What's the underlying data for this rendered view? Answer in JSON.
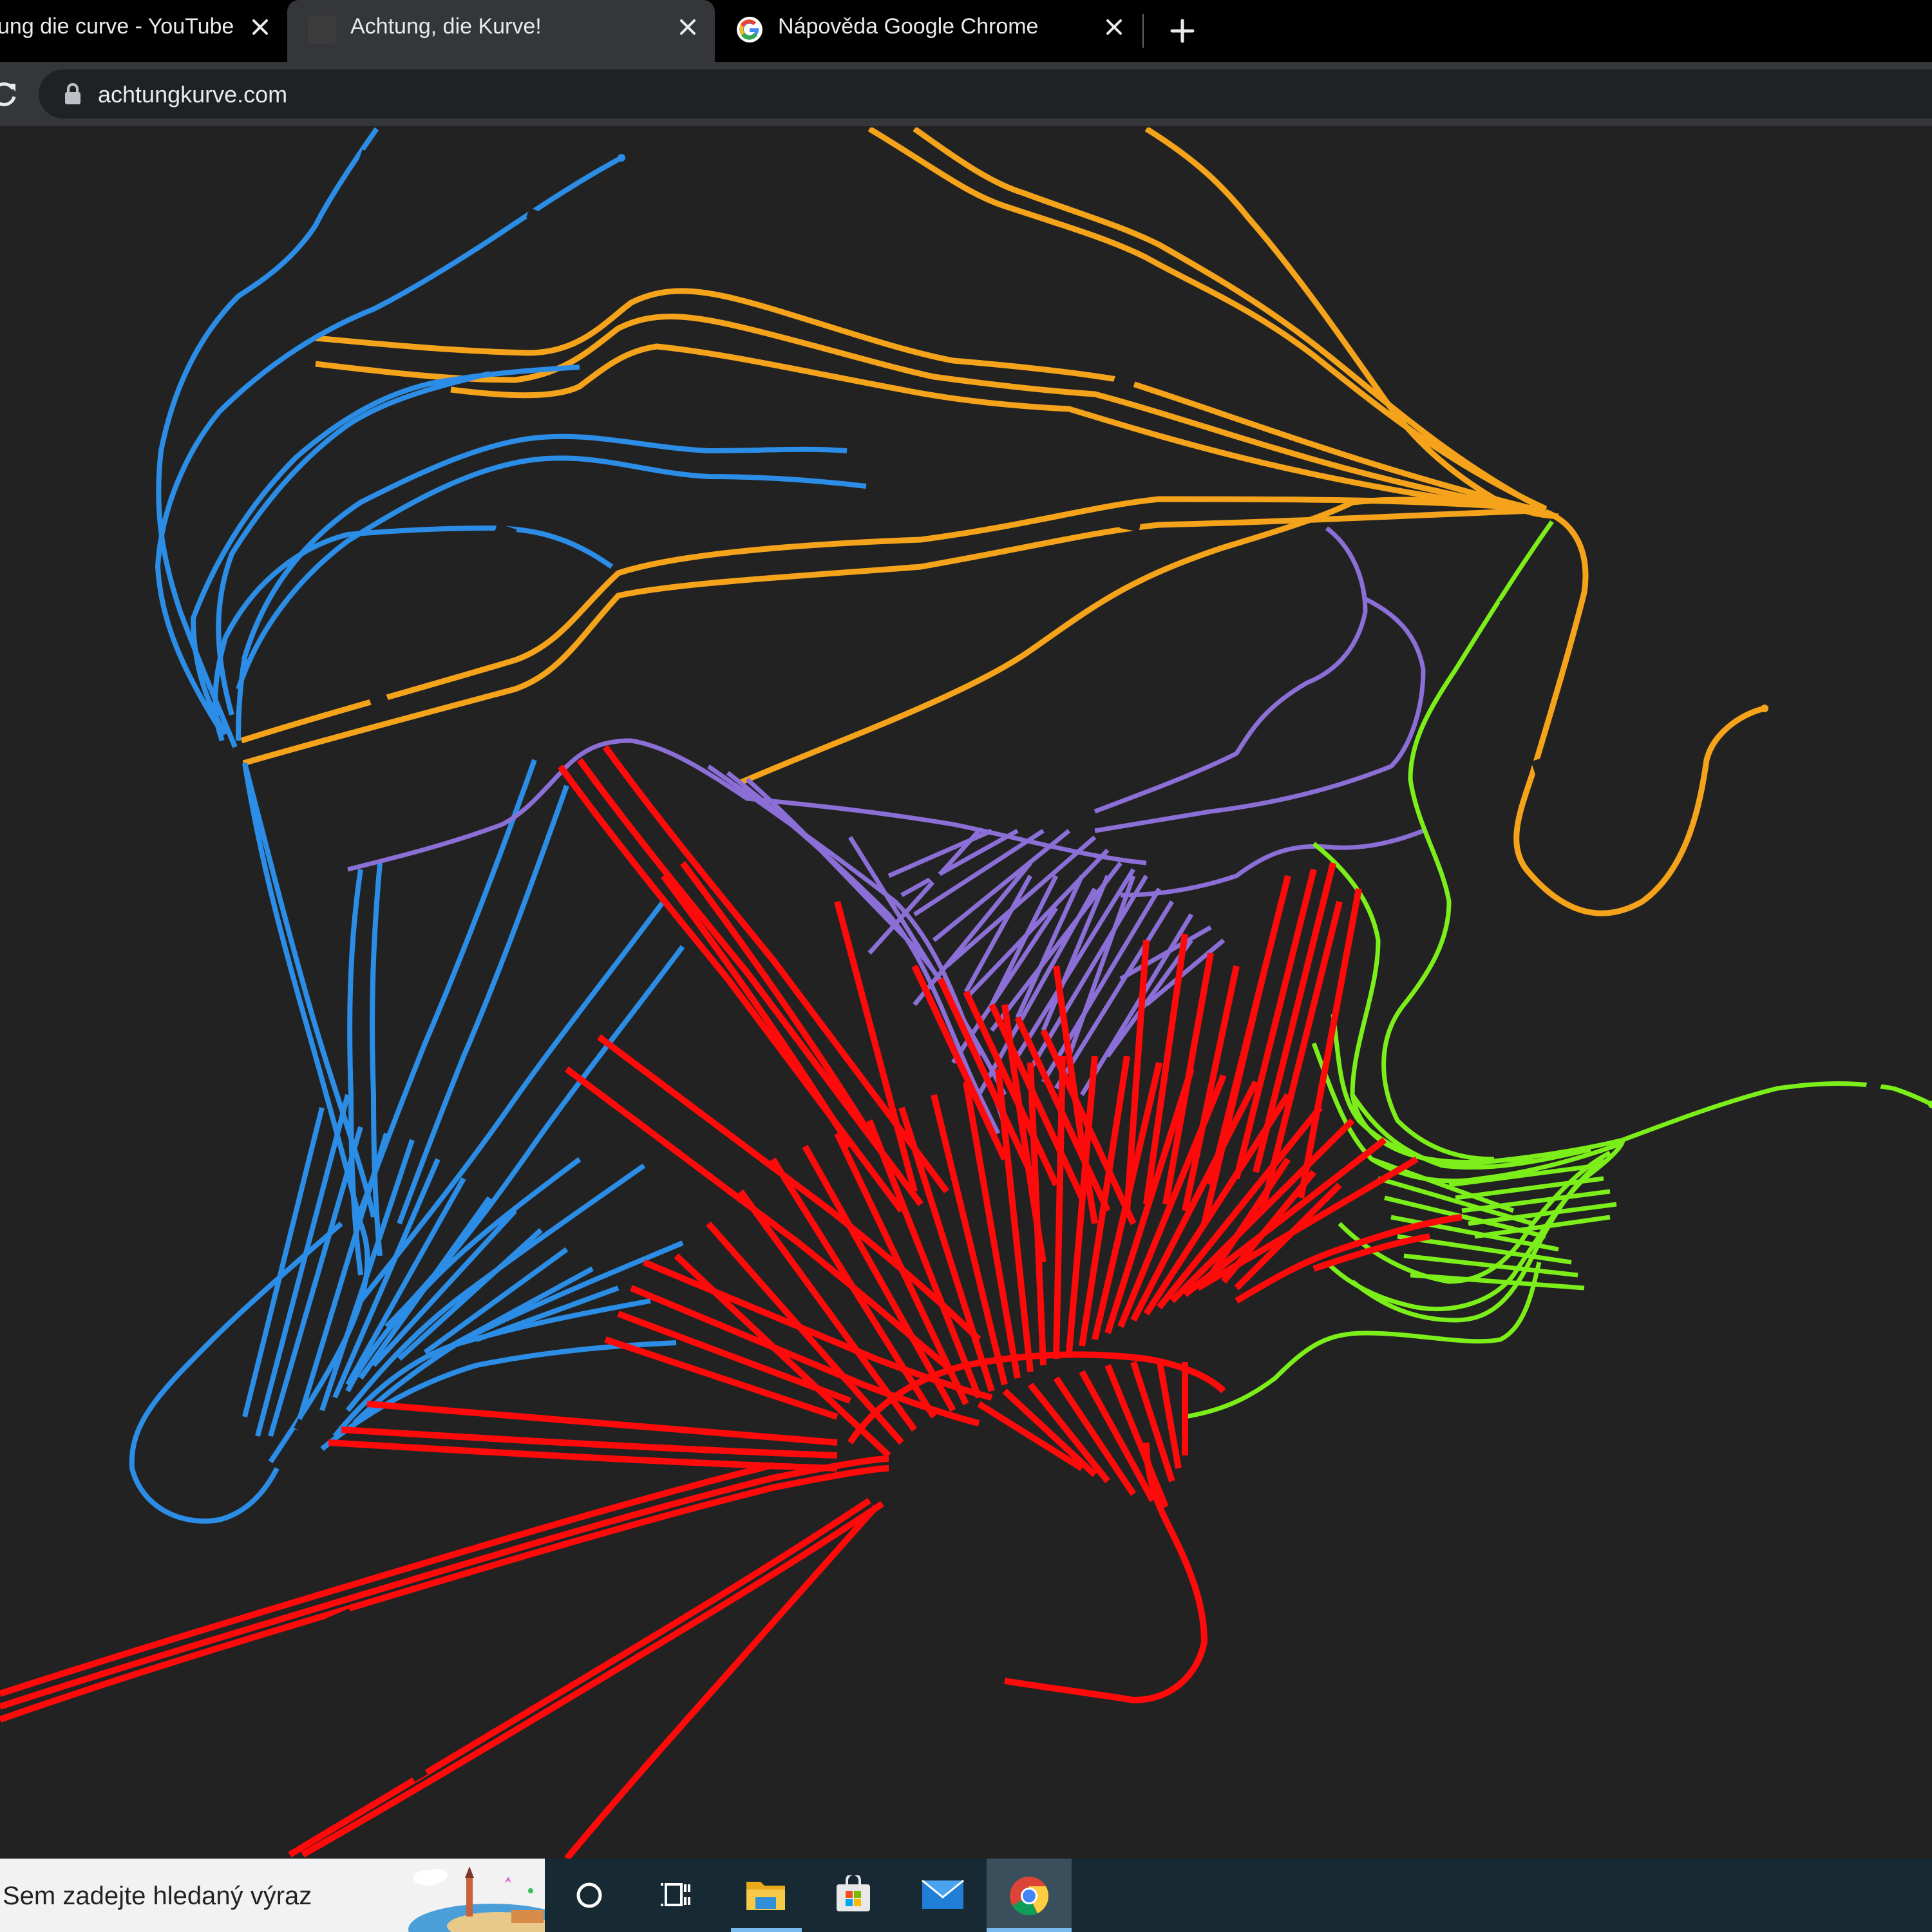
{
  "browser": {
    "tabs": [
      {
        "title": "ung die curve - YouTube",
        "active": false,
        "favicon": "none"
      },
      {
        "title": "Achtung, die Kurve!",
        "active": true,
        "favicon": "blank-page-icon"
      },
      {
        "title": "Nápověda Google Chrome",
        "active": false,
        "favicon": "google-g-icon"
      }
    ],
    "url": "achtungkurve.com",
    "new_tab_label": "+"
  },
  "game": {
    "player_colors": {
      "blue": "#2b8de6",
      "orange": "#f5a31a",
      "purple": "#8b6fd6",
      "red": "#ff0a0a",
      "green": "#7cee1a"
    }
  },
  "taskbar": {
    "search_placeholder": "Sem zadejte hledaný výraz",
    "apps": [
      "cortana-icon",
      "task-view-icon",
      "file-explorer-icon",
      "microsoft-store-icon",
      "mail-icon",
      "chrome-icon"
    ],
    "active_app": "chrome-icon",
    "accent": "#76b9ed"
  }
}
